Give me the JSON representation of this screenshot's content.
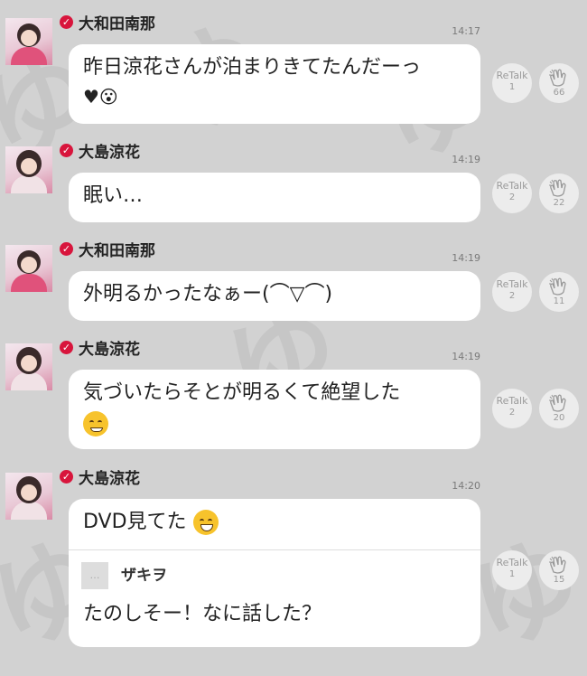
{
  "messages": [
    {
      "name": "大和田南那",
      "time": "14:17",
      "text": "昨日涼花さんが泊まりきてたんだーっ",
      "text2": "♥︎😮",
      "retalk_label": "ReTalk",
      "retalk": "1",
      "claps": "66"
    },
    {
      "name": "大島涼花",
      "time": "14:19",
      "text": "眠い…",
      "retalk_label": "ReTalk",
      "retalk": "2",
      "claps": "22"
    },
    {
      "name": "大和田南那",
      "time": "14:19",
      "text": "外明るかったなぁー(⌒▽⌒)",
      "retalk_label": "ReTalk",
      "retalk": "2",
      "claps": "11"
    },
    {
      "name": "大島涼花",
      "time": "14:19",
      "text": "気づいたらそとが明るくて絶望した",
      "retalk_label": "ReTalk",
      "retalk": "2",
      "claps": "20"
    },
    {
      "name": "大島涼花",
      "time": "14:20",
      "text": "DVD見てた",
      "retalk_label": "ReTalk",
      "retalk": "1",
      "claps": "15",
      "quote": {
        "name": "ザキヲ",
        "icon": "…",
        "text": "たのしそー！なに話した？"
      }
    }
  ],
  "verified_color": "#d8153c",
  "icons": {
    "verified": "verified-check-icon",
    "clap": "clap-icon"
  }
}
